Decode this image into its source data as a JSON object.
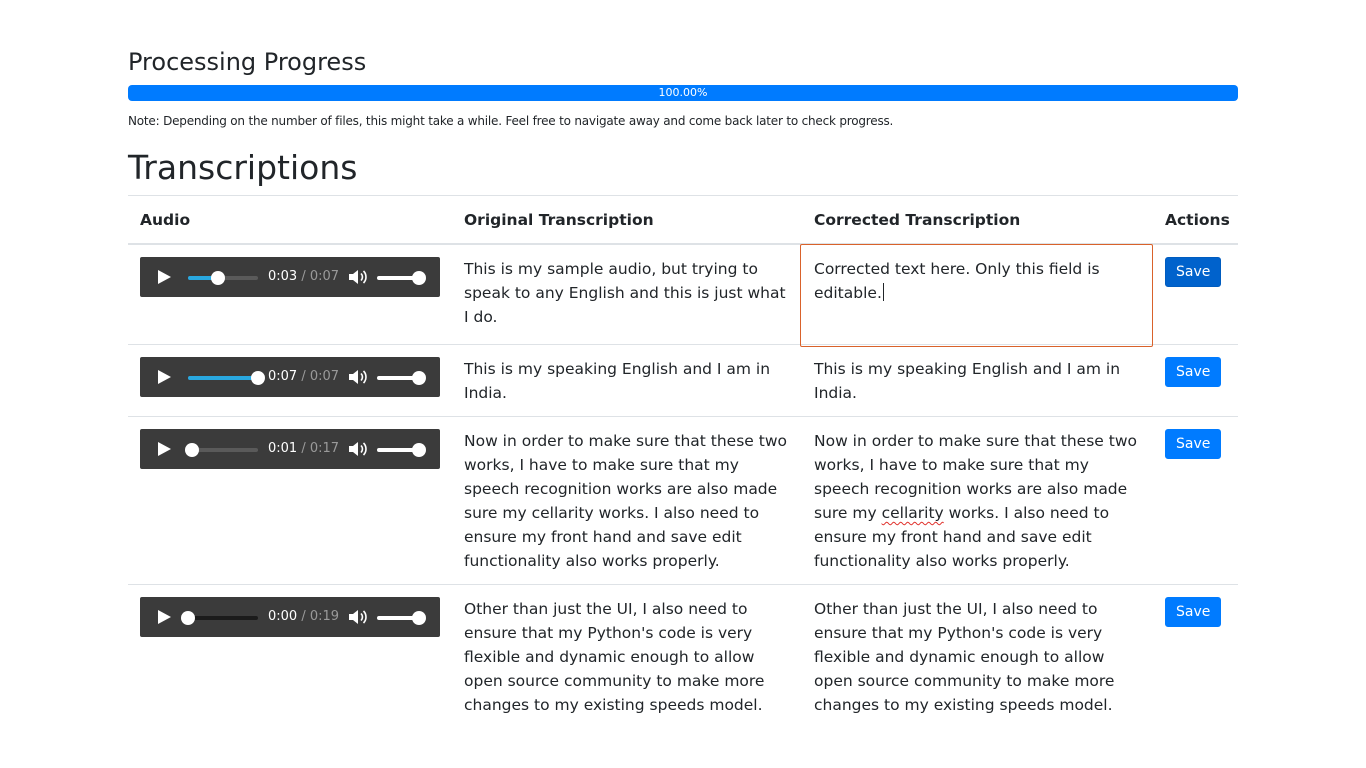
{
  "progress_section": {
    "title": "Processing Progress",
    "percent_label": "100.00%",
    "percent": 100,
    "bar_color": "#007bff",
    "note": "Note: Depending on the number of files, this might take a while. Feel free to navigate away and come back later to check progress."
  },
  "transcriptions": {
    "title": "Transcriptions",
    "columns": [
      "Audio",
      "Original Transcription",
      "Corrected Transcription",
      "Actions"
    ],
    "rows": [
      {
        "audio": {
          "current": "0:03",
          "separator": "/",
          "total": "0:07",
          "played_fraction": 0.43,
          "volume_fraction": 1.0
        },
        "original": "This is my sample audio, but trying to speak to any English and this is just what I do.",
        "corrected": "Corrected text here. Only this field is editable.",
        "action_label": "Save"
      },
      {
        "audio": {
          "current": "0:07",
          "separator": "/",
          "total": "0:07",
          "played_fraction": 1.0,
          "volume_fraction": 1.0
        },
        "original": "This is my speaking English and I am in India.",
        "corrected": "This is my speaking English and I am in India.",
        "action_label": "Save"
      },
      {
        "audio": {
          "current": "0:01",
          "separator": "/",
          "total": "0:17",
          "played_fraction": 0.06,
          "volume_fraction": 1.0
        },
        "original": "Now in order to make sure that these two works, I have to make sure that my speech recognition works are also made sure my cellarity works. I also need to ensure my front hand and save edit functionality also works properly.",
        "corrected_before": "Now in order to make sure that these two works, I have to make sure that my speech recognition works are also made sure my ",
        "corrected_misspelled": "cellarity",
        "corrected_after": " works. I also need to ensure my front hand and save edit functionality also works properly.",
        "action_label": "Save"
      },
      {
        "audio": {
          "current": "0:00",
          "separator": "/",
          "total": "0:19",
          "played_fraction": 0.0,
          "volume_fraction": 1.0
        },
        "original": "Other than just the UI, I also need to ensure that my Python's code is very flexible and dynamic enough to allow open source community to make more changes to my existing speeds model.",
        "corrected": "Other than just the UI, I also need to ensure that my Python's code is very flexible and dynamic enough to allow open source community to make more changes to my existing speeds model.",
        "action_label": "Save"
      }
    ]
  }
}
